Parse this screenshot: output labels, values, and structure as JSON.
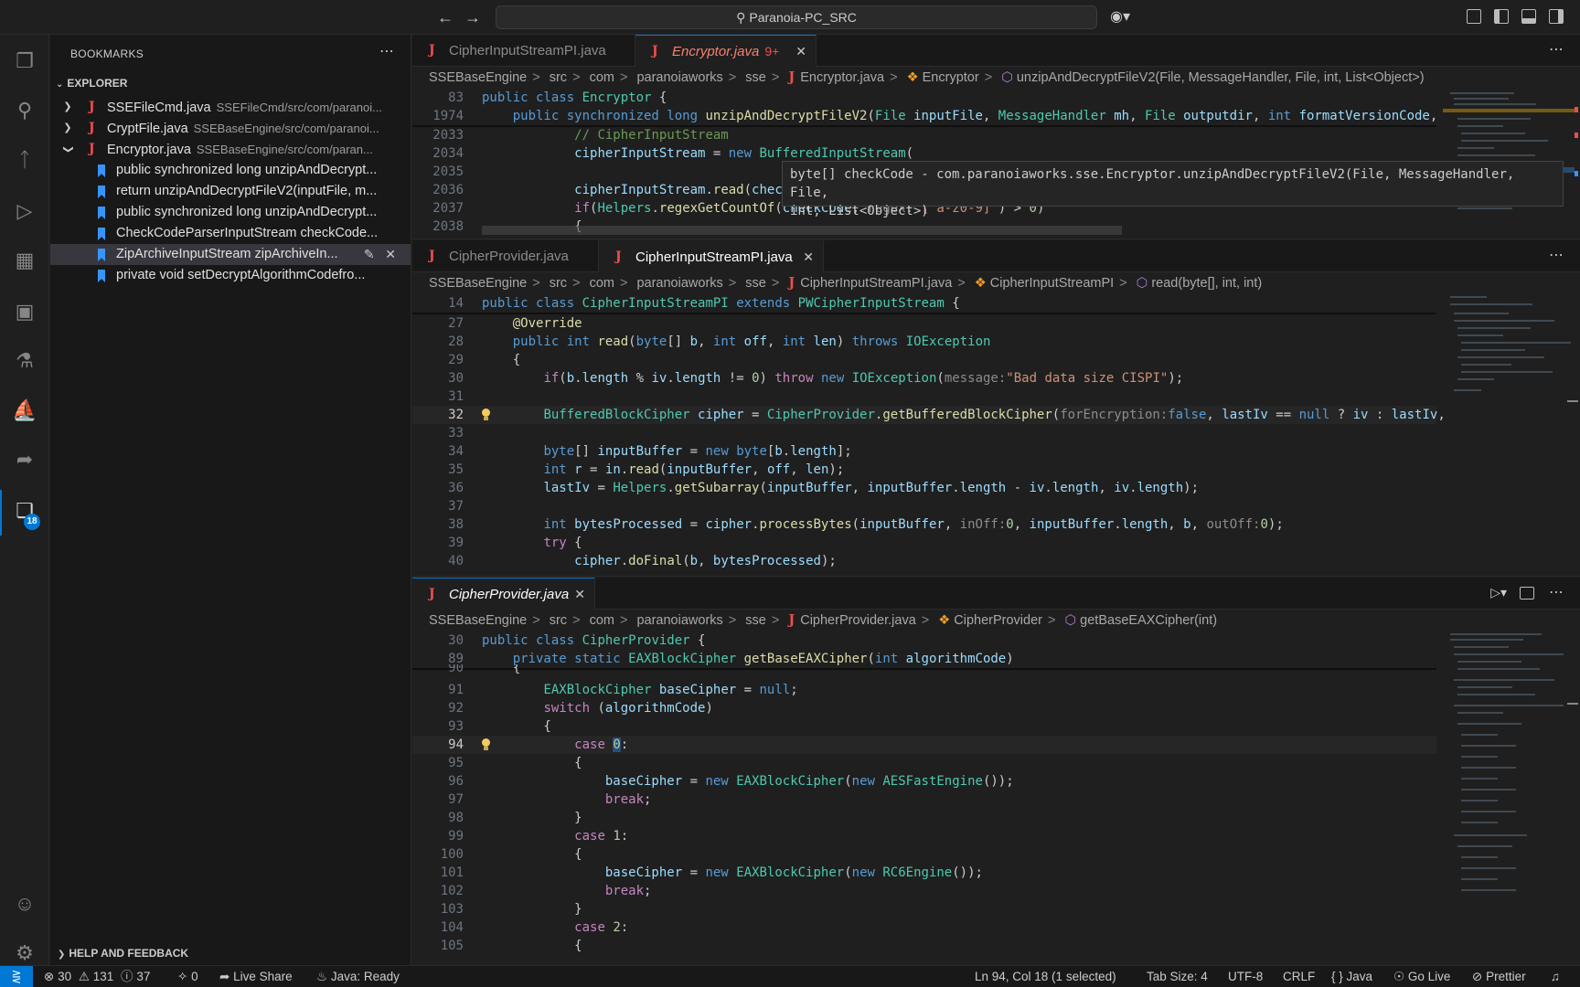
{
  "titlebar": {
    "search_text": "Paranoia-PC_SRC",
    "back_icon": "arrow-left-icon",
    "forward_icon": "arrow-right-icon",
    "copilot_icon": "copilot-icon"
  },
  "activity_bar": {
    "items": [
      "explorer-icon",
      "search-icon",
      "source-control-icon",
      "run-debug-icon",
      "extensions-icon",
      "remote-explorer-icon",
      "testing-icon",
      "docker-icon",
      "live-share-icon",
      "bookmarks-icon"
    ],
    "bookmarks_badge": "18",
    "bottom": [
      "accounts-icon",
      "manage-gear-icon"
    ]
  },
  "sidebar": {
    "title": "BOOKMARKS",
    "explorer_label": "EXPLORER",
    "help_label": "HELP AND FEEDBACK",
    "files": [
      {
        "name": "SSEFileCmd.java",
        "path": "SSEFileCmd/src/com/paranoi..."
      },
      {
        "name": "CryptFile.java",
        "path": "SSEBaseEngine/src/com/paranoi..."
      },
      {
        "name": "Encryptor.java",
        "path": "SSEBaseEngine/src/com/paran..."
      }
    ],
    "bookmarks": [
      "public synchronized long unzipAndDecrypt...",
      "return unzipAndDecryptFileV2(inputFile, m...",
      "public synchronized long unzipAndDecrypt...",
      "CheckCodeParserInputStream checkCode...",
      "ZipArchiveInputStream zipArchiveIn...",
      "private void setDecryptAlgorithmCodefro..."
    ]
  },
  "group1": {
    "tabs": [
      {
        "label": "CipherInputStreamPI.java"
      },
      {
        "label": "Encryptor.java",
        "errors": "9+"
      }
    ],
    "breadcrumbs": [
      "SSEBaseEngine",
      "src",
      "com",
      "paranoiaworks",
      "sse",
      "Encryptor.java",
      "Encryptor",
      "unzipAndDecryptFileV2(File, MessageHandler, File, int, List<Object>)"
    ],
    "line_numbers": [
      "83",
      "1974",
      "2033",
      "2034",
      "2035",
      "2036",
      "2037",
      "2038"
    ],
    "hover_line1": "byte[] checkCode - com.paranoiaworks.sse.Encryptor.unzipAndDecryptFileV2(File, MessageHandler, File,",
    "hover_line2": "int, List<Object>)"
  },
  "group2": {
    "tabs": [
      {
        "label": "CipherProvider.java"
      },
      {
        "label": "CipherInputStreamPI.java"
      }
    ],
    "breadcrumbs": [
      "SSEBaseEngine",
      "src",
      "com",
      "paranoiaworks",
      "sse",
      "CipherInputStreamPI.java",
      "CipherInputStreamPI",
      "read(byte[], int, int)"
    ],
    "line_numbers": [
      "14",
      "27",
      "28",
      "29",
      "30",
      "31",
      "32",
      "33",
      "34",
      "35",
      "36",
      "37",
      "38",
      "39",
      "40"
    ]
  },
  "group3": {
    "tabs": [
      {
        "label": "CipherProvider.java"
      }
    ],
    "breadcrumbs": [
      "SSEBaseEngine",
      "src",
      "com",
      "paranoiaworks",
      "sse",
      "CipherProvider.java",
      "CipherProvider",
      "getBaseEAXCipher(int)"
    ],
    "line_numbers": [
      "30",
      "89",
      "90",
      "91",
      "92",
      "93",
      "94",
      "95",
      "96",
      "97",
      "98",
      "99",
      "100",
      "101",
      "102",
      "103",
      "104",
      "105"
    ]
  },
  "statusbar": {
    "errors": "30",
    "warnings": "131",
    "infos": "37",
    "ports": "0",
    "live_share": "Live Share",
    "java_status": "Java: Ready",
    "cursor": "Ln 94, Col 18 (1 selected)",
    "tab_size": "Tab Size: 4",
    "encoding": "UTF-8",
    "eol": "CRLF",
    "language": "Java",
    "go_live": "Go Live",
    "prettier": "Prettier"
  },
  "colors": {
    "accent": "#0078d4",
    "java_icon": "#f14c4c",
    "bookmark": "#3794ff"
  }
}
